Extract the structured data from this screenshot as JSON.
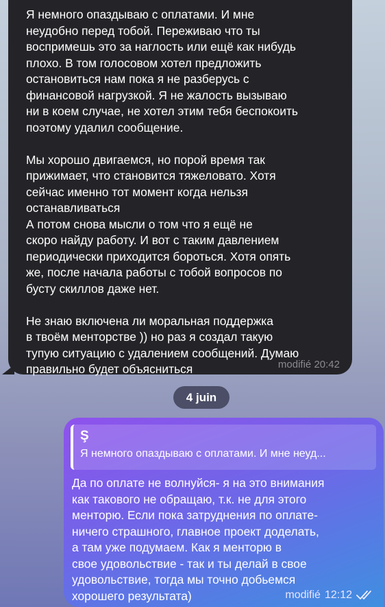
{
  "incoming_message": {
    "text": "Я немного опаздываю с оплатами. И мне\nнеудобно перед тобой. Переживаю что ты\nвоспримешь это за наглость или ещё как нибудь\nплохо. В том голосовом хотел предложить\nостановиться нам пока я не разберусь с\nфинансовой нагрузкой. Я не жалость вызываю\nни в коем случае, не хотел этим тебя беспокоить\nпоэтому удалил сообщение.\n\nМы хорошо двигаемся, но порой время так\nприжимает, что становится тяжеловато. Хотя\nсейчас именно тот момент когда нельзя\nостанавливаться\nА потом снова мысли о том что я ещё не\nскоро найду работу. И вот с таким давлением\nпериодически приходится бороться. Хотя опять\nже, после начала работы с тобой вопросов по\nбусту скиллов даже нет.\n\nНе знаю включена ли моральная поддержка\nв твоём менторстве )) но раз я создал такую\nтупую ситуацию с удалением сообщений. Думаю\nправильно будет объясниться",
    "status": "modifié",
    "time": "20:42"
  },
  "date_separator": "4 juin",
  "outgoing_message": {
    "reply_author": "Ş",
    "reply_preview": "Я немного опаздываю с оплатами. И мне неуд...",
    "text": "Да по оплате не волнуйся- я на это внимания\nкак такового не обращаю, т.к. не для этого\nменторю. Если пока затруднения по оплате-\nничего страшного, главное проект доделать,\nа там уже подумаем. Как я менторю в\nсвое удовольствие - так и ты делай в свое\nудовольствие, тогда мы точно добьемся\nхорошего результата)",
    "status": "modifié",
    "time": "12:12",
    "read_icon": "double-check-icon"
  },
  "colors": {
    "incoming_bubble": "#242428",
    "date_pill": "#4b4e66",
    "outgoing_gradient_start": "#8f52ec",
    "outgoing_gradient_end": "#3f8fe0"
  }
}
